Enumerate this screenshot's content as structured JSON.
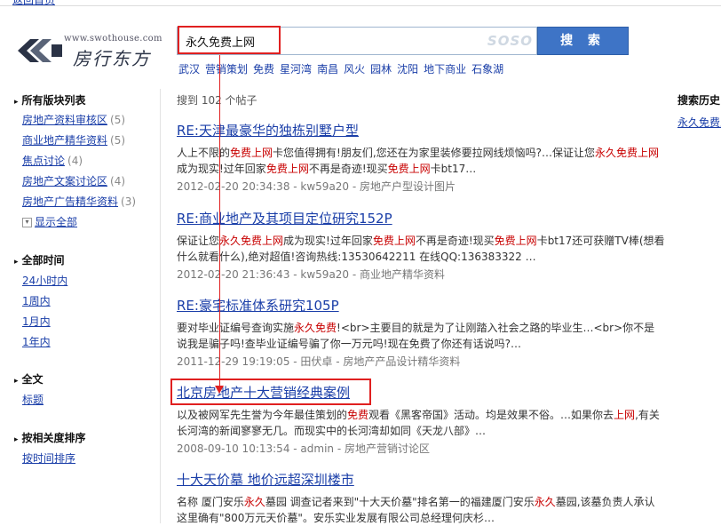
{
  "top": {
    "back_home": "返回首页"
  },
  "logo": {
    "url": "www.swothouse.com",
    "name": "房行东方"
  },
  "search": {
    "query": "永久免费上网",
    "engine_mark": "SOSO",
    "button": "搜 索"
  },
  "hotwords": [
    "武汉",
    "营销策划",
    "免费",
    "星河湾",
    "南昌",
    "风火",
    "园林",
    "沈阳",
    "地下商业",
    "石象湖"
  ],
  "sidebar": {
    "boards_title": "所有版块列表",
    "boards": [
      {
        "label": "房地产资料审核区",
        "count": "(5)"
      },
      {
        "label": "商业地产精华资料",
        "count": "(5)"
      },
      {
        "label": "焦点讨论",
        "count": "(4)"
      },
      {
        "label": "房地产文案讨论区",
        "count": "(4)"
      },
      {
        "label": "房地产广告精华资料",
        "count": "(3)"
      }
    ],
    "show_all": "显示全部",
    "time_title": "全部时间",
    "times": [
      "24小时内",
      "1周内",
      "1月内",
      "1年内"
    ],
    "scope_title": "全文",
    "scopes": [
      "标题"
    ],
    "sort_title": "按相关度排序",
    "sorts": [
      "按时间排序"
    ]
  },
  "results_count": "搜到 102 个帖子",
  "results": [
    {
      "title": "RE:天津最豪华的独栋别墅户型",
      "snippet_html": "人上不限的<em>免费上网</em>卡您值得拥有!朋友们,您还在为家里装修要拉网线烦恼吗?…保证让您<em>永久免费上</em><em>网</em>成为现实!过年回家<em>免费上网</em>不再是奇迹!现买<em>免费上网</em>卡bt17…",
      "meta": "2012-02-20 20:34:38 - kw59a20 - 房地产户型设计图片"
    },
    {
      "title": "RE:商业地产及其项目定位研究152P",
      "snippet_html": "保证让您<em>永久免费上网</em>成为现实!过年回家<em>免费上网</em>不再是奇迹!现买<em>免费上网</em>卡bt17还可获赠TV棒(想看什么就看什么),绝对超值!咨询热线:13530642211 在线QQ:136383322 …",
      "meta": "2012-02-20 21:36:43 - kw59a20 - 商业地产精华资料"
    },
    {
      "title": "RE:豪宅标准体系研究105P",
      "snippet_html": "要对毕业证编号查询实施<em>永久免费</em>!&lt;br&gt;主要目的就是为了让刚踏入社会之路的毕业生…&lt;br&gt;你不是说我是骗子吗!查毕业证编号骗了你一万元吗!现在免费了你还有话说吗?…",
      "meta": "2011-12-29 19:19:05 - 田伏卓 - 房地产产品设计精华资料"
    },
    {
      "title": "北京房地产十大营销经典案例",
      "snippet_html": "以及被网军先生誉为今年最佳策划的<em>免费</em>观看《黑客帝国》活动。均是效果不俗。…如果你去<em>上网</em>,有关长河湾的新闻寥寥无几。而现实中的长河湾却如同《天龙八部》…",
      "meta": "2008-09-10 10:13:54 - admin - 房地产营销讨论区"
    },
    {
      "title": "十大天价墓 地价远超深圳楼市",
      "snippet_html": "名称 厦门安乐<em>永久</em>墓园 调查记者来到\"十大天价墓\"排名第一的福建厦门安乐<em>永久</em>墓园,该墓负责人承认这里确有\"800万元天价墓\"。安乐实业发展有限公司总经理何庆杉…",
      "meta": ""
    }
  ],
  "history": {
    "title": "搜索历史",
    "items": [
      "永久免费上网"
    ]
  },
  "annotation_color": "#e02020"
}
